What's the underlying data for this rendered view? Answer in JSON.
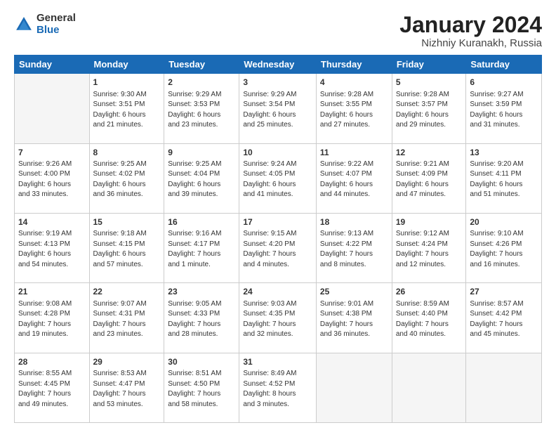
{
  "logo": {
    "general": "General",
    "blue": "Blue"
  },
  "header": {
    "month": "January 2024",
    "location": "Nizhniy Kuranakh, Russia"
  },
  "weekdays": [
    "Sunday",
    "Monday",
    "Tuesday",
    "Wednesday",
    "Thursday",
    "Friday",
    "Saturday"
  ],
  "weeks": [
    [
      {
        "day": "",
        "info": ""
      },
      {
        "day": "1",
        "info": "Sunrise: 9:30 AM\nSunset: 3:51 PM\nDaylight: 6 hours\nand 21 minutes."
      },
      {
        "day": "2",
        "info": "Sunrise: 9:29 AM\nSunset: 3:53 PM\nDaylight: 6 hours\nand 23 minutes."
      },
      {
        "day": "3",
        "info": "Sunrise: 9:29 AM\nSunset: 3:54 PM\nDaylight: 6 hours\nand 25 minutes."
      },
      {
        "day": "4",
        "info": "Sunrise: 9:28 AM\nSunset: 3:55 PM\nDaylight: 6 hours\nand 27 minutes."
      },
      {
        "day": "5",
        "info": "Sunrise: 9:28 AM\nSunset: 3:57 PM\nDaylight: 6 hours\nand 29 minutes."
      },
      {
        "day": "6",
        "info": "Sunrise: 9:27 AM\nSunset: 3:59 PM\nDaylight: 6 hours\nand 31 minutes."
      }
    ],
    [
      {
        "day": "7",
        "info": "Sunrise: 9:26 AM\nSunset: 4:00 PM\nDaylight: 6 hours\nand 33 minutes."
      },
      {
        "day": "8",
        "info": "Sunrise: 9:25 AM\nSunset: 4:02 PM\nDaylight: 6 hours\nand 36 minutes."
      },
      {
        "day": "9",
        "info": "Sunrise: 9:25 AM\nSunset: 4:04 PM\nDaylight: 6 hours\nand 39 minutes."
      },
      {
        "day": "10",
        "info": "Sunrise: 9:24 AM\nSunset: 4:05 PM\nDaylight: 6 hours\nand 41 minutes."
      },
      {
        "day": "11",
        "info": "Sunrise: 9:22 AM\nSunset: 4:07 PM\nDaylight: 6 hours\nand 44 minutes."
      },
      {
        "day": "12",
        "info": "Sunrise: 9:21 AM\nSunset: 4:09 PM\nDaylight: 6 hours\nand 47 minutes."
      },
      {
        "day": "13",
        "info": "Sunrise: 9:20 AM\nSunset: 4:11 PM\nDaylight: 6 hours\nand 51 minutes."
      }
    ],
    [
      {
        "day": "14",
        "info": "Sunrise: 9:19 AM\nSunset: 4:13 PM\nDaylight: 6 hours\nand 54 minutes."
      },
      {
        "day": "15",
        "info": "Sunrise: 9:18 AM\nSunset: 4:15 PM\nDaylight: 6 hours\nand 57 minutes."
      },
      {
        "day": "16",
        "info": "Sunrise: 9:16 AM\nSunset: 4:17 PM\nDaylight: 7 hours\nand 1 minute."
      },
      {
        "day": "17",
        "info": "Sunrise: 9:15 AM\nSunset: 4:20 PM\nDaylight: 7 hours\nand 4 minutes."
      },
      {
        "day": "18",
        "info": "Sunrise: 9:13 AM\nSunset: 4:22 PM\nDaylight: 7 hours\nand 8 minutes."
      },
      {
        "day": "19",
        "info": "Sunrise: 9:12 AM\nSunset: 4:24 PM\nDaylight: 7 hours\nand 12 minutes."
      },
      {
        "day": "20",
        "info": "Sunrise: 9:10 AM\nSunset: 4:26 PM\nDaylight: 7 hours\nand 16 minutes."
      }
    ],
    [
      {
        "day": "21",
        "info": "Sunrise: 9:08 AM\nSunset: 4:28 PM\nDaylight: 7 hours\nand 19 minutes."
      },
      {
        "day": "22",
        "info": "Sunrise: 9:07 AM\nSunset: 4:31 PM\nDaylight: 7 hours\nand 23 minutes."
      },
      {
        "day": "23",
        "info": "Sunrise: 9:05 AM\nSunset: 4:33 PM\nDaylight: 7 hours\nand 28 minutes."
      },
      {
        "day": "24",
        "info": "Sunrise: 9:03 AM\nSunset: 4:35 PM\nDaylight: 7 hours\nand 32 minutes."
      },
      {
        "day": "25",
        "info": "Sunrise: 9:01 AM\nSunset: 4:38 PM\nDaylight: 7 hours\nand 36 minutes."
      },
      {
        "day": "26",
        "info": "Sunrise: 8:59 AM\nSunset: 4:40 PM\nDaylight: 7 hours\nand 40 minutes."
      },
      {
        "day": "27",
        "info": "Sunrise: 8:57 AM\nSunset: 4:42 PM\nDaylight: 7 hours\nand 45 minutes."
      }
    ],
    [
      {
        "day": "28",
        "info": "Sunrise: 8:55 AM\nSunset: 4:45 PM\nDaylight: 7 hours\nand 49 minutes."
      },
      {
        "day": "29",
        "info": "Sunrise: 8:53 AM\nSunset: 4:47 PM\nDaylight: 7 hours\nand 53 minutes."
      },
      {
        "day": "30",
        "info": "Sunrise: 8:51 AM\nSunset: 4:50 PM\nDaylight: 7 hours\nand 58 minutes."
      },
      {
        "day": "31",
        "info": "Sunrise: 8:49 AM\nSunset: 4:52 PM\nDaylight: 8 hours\nand 3 minutes."
      },
      {
        "day": "",
        "info": ""
      },
      {
        "day": "",
        "info": ""
      },
      {
        "day": "",
        "info": ""
      }
    ]
  ]
}
